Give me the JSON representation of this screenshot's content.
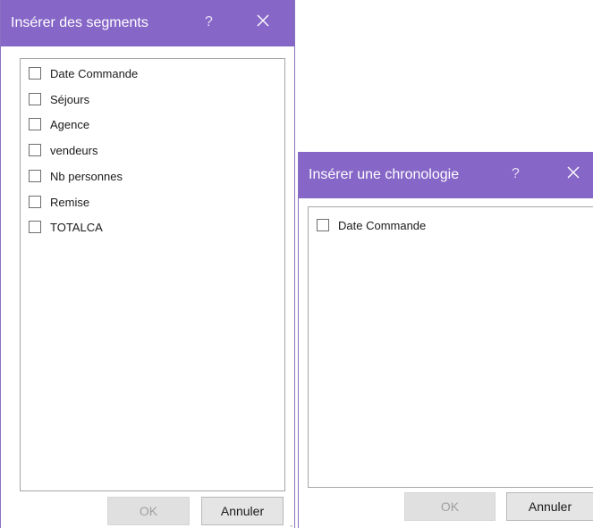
{
  "colors": {
    "titlebar": "#8666c7",
    "border": "#8a72c2",
    "ok_disabled": "#e0e0e0",
    "cancel_bg": "#e5e5e5"
  },
  "slicer_dialog": {
    "title": "Insérer des segments",
    "help_label": "?",
    "close_icon": "close-icon",
    "fields": [
      {
        "label": "Date Commande",
        "checked": false
      },
      {
        "label": "Séjours",
        "checked": false
      },
      {
        "label": "Agence",
        "checked": false
      },
      {
        "label": "vendeurs",
        "checked": false
      },
      {
        "label": "Nb personnes",
        "checked": false
      },
      {
        "label": "Remise",
        "checked": false
      },
      {
        "label": "TOTALCA",
        "checked": false
      }
    ],
    "ok_label": "OK",
    "cancel_label": "Annuler"
  },
  "timeline_dialog": {
    "title": "Insérer une chronologie",
    "help_label": "?",
    "close_icon": "close-icon",
    "fields": [
      {
        "label": "Date Commande",
        "checked": false
      }
    ],
    "ok_label": "OK",
    "cancel_label": "Annuler"
  }
}
